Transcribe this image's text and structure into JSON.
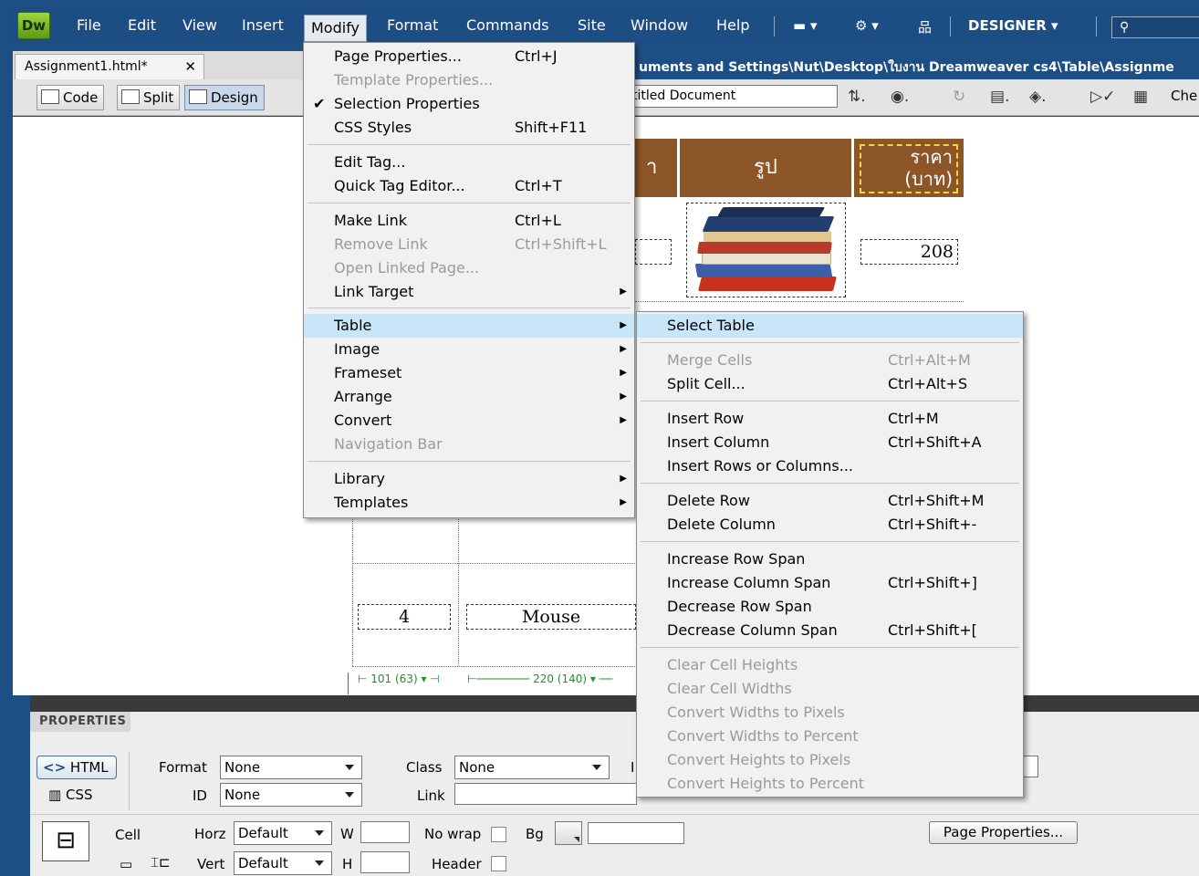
{
  "app": {
    "logo": "Dw",
    "menus": [
      "File",
      "Edit",
      "View",
      "Insert",
      "Modify",
      "Format",
      "Commands",
      "Site",
      "Window",
      "Help"
    ],
    "workspace": "DESIGNER"
  },
  "document": {
    "tab": "Assignment1.html*",
    "tab_close": "✕",
    "path": "uments and Settings\\Nut\\Desktop\\ใบงาน Dreamweaver cs4\\Table\\Assignme",
    "views": {
      "code": "Code",
      "split": "Split",
      "design": "Design"
    },
    "title_value": "titled Document",
    "check_label": "Che"
  },
  "table": {
    "headers": [
      "า",
      "รูป",
      "ราคา (บาท)"
    ],
    "price": "208",
    "row4": {
      "num": "4",
      "name": "Mouse"
    },
    "widths": {
      "col1": "101 (63)",
      "col2": "220 (140)"
    }
  },
  "modify_menu": {
    "items": [
      {
        "label": "Page Properties...",
        "shortcut": "Ctrl+J"
      },
      {
        "label": "Template Properties...",
        "disabled": true
      },
      {
        "label": "Selection Properties",
        "checked": true
      },
      {
        "label": "CSS Styles",
        "shortcut": "Shift+F11"
      },
      {
        "label": "Edit Tag..."
      },
      {
        "label": "Quick Tag Editor...",
        "shortcut": "Ctrl+T"
      },
      {
        "label": "Make Link",
        "shortcut": "Ctrl+L"
      },
      {
        "label": "Remove Link",
        "shortcut": "Ctrl+Shift+L",
        "disabled": true
      },
      {
        "label": "Open Linked Page...",
        "disabled": true
      },
      {
        "label": "Link Target",
        "submenu": true
      },
      {
        "label": "Table",
        "submenu": true,
        "highlighted": true
      },
      {
        "label": "Image",
        "submenu": true
      },
      {
        "label": "Frameset",
        "submenu": true
      },
      {
        "label": "Arrange",
        "submenu": true
      },
      {
        "label": "Convert",
        "submenu": true
      },
      {
        "label": "Navigation Bar",
        "disabled": true
      },
      {
        "label": "Library",
        "submenu": true
      },
      {
        "label": "Templates",
        "submenu": true
      }
    ]
  },
  "table_submenu": {
    "items": [
      {
        "label": "Select Table",
        "highlighted": true
      },
      {
        "label": "Merge Cells",
        "shortcut": "Ctrl+Alt+M",
        "disabled": true
      },
      {
        "label": "Split Cell...",
        "shortcut": "Ctrl+Alt+S"
      },
      {
        "label": "Insert Row",
        "shortcut": "Ctrl+M"
      },
      {
        "label": "Insert Column",
        "shortcut": "Ctrl+Shift+A"
      },
      {
        "label": "Insert Rows or Columns..."
      },
      {
        "label": "Delete Row",
        "shortcut": "Ctrl+Shift+M"
      },
      {
        "label": "Delete Column",
        "shortcut": "Ctrl+Shift+-"
      },
      {
        "label": "Increase Row Span"
      },
      {
        "label": "Increase Column Span",
        "shortcut": "Ctrl+Shift+]"
      },
      {
        "label": "Decrease Row Span"
      },
      {
        "label": "Decrease Column Span",
        "shortcut": "Ctrl+Shift+["
      },
      {
        "label": "Clear Cell Heights",
        "disabled": true
      },
      {
        "label": "Clear Cell Widths",
        "disabled": true
      },
      {
        "label": "Convert Widths to Pixels",
        "disabled": true
      },
      {
        "label": "Convert Widths to Percent",
        "disabled": true
      },
      {
        "label": "Convert Heights to Pixels",
        "disabled": true
      },
      {
        "label": "Convert Heights to Percent",
        "disabled": true
      }
    ]
  },
  "properties": {
    "title": "PROPERTIES",
    "html_btn": "HTML",
    "css_btn": "CSS",
    "format_label": "Format",
    "format_value": "None",
    "class_label": "Class",
    "class_value": "None",
    "id_label": "ID",
    "id_value": "None",
    "link_label": "Link",
    "cell_label": "Cell",
    "horz_label": "Horz",
    "horz_value": "Default",
    "vert_label": "Vert",
    "vert_value": "Default",
    "w_label": "W",
    "h_label": "H",
    "nowrap_label": "No wrap",
    "header_label": "Header",
    "bg_label": "Bg",
    "page_props_btn": "Page Properties...",
    "cut_label": "I"
  }
}
